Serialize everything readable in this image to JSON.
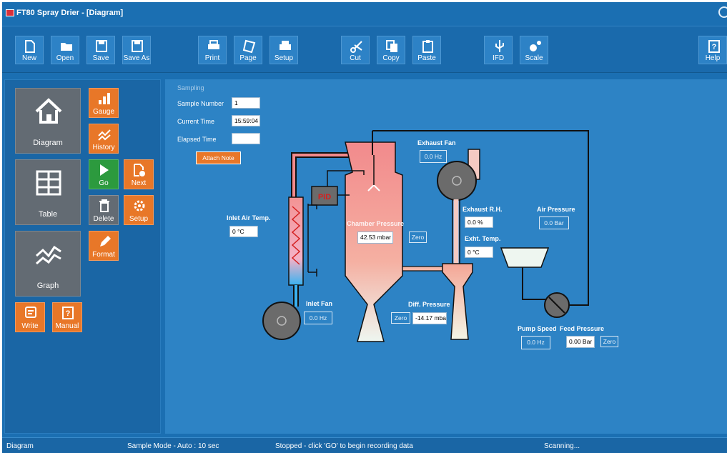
{
  "window": {
    "title": "FT80 Spray Drier - [Diagram]"
  },
  "toolbar": {
    "new": "New",
    "open": "Open",
    "save": "Save",
    "save_as": "Save As",
    "print": "Print",
    "page": "Page",
    "setup": "Setup",
    "cut": "Cut",
    "copy": "Copy",
    "paste": "Paste",
    "ifd": "IFD",
    "scale": "Scale",
    "help": "Help"
  },
  "sidebar": {
    "diagram": "Diagram",
    "table": "Table",
    "graph": "Graph",
    "gauge": "Gauge",
    "history": "History",
    "go": "Go",
    "next": "Next",
    "delete": "Delete",
    "setup": "Setup",
    "format": "Format",
    "write": "Write",
    "manual": "Manual"
  },
  "sampling": {
    "heading": "Sampling",
    "sample_number_label": "Sample Number",
    "sample_number": "1",
    "current_time_label": "Current Time",
    "current_time": "15:59:04",
    "elapsed_time_label": "Elapsed Time",
    "elapsed_time": "",
    "attach_note": "Attach Note"
  },
  "diagram": {
    "pid": "PID",
    "inlet_air_temp_label": "Inlet Air Temp.",
    "inlet_air_temp": "0 °C",
    "inlet_fan_label": "Inlet Fan",
    "inlet_fan": "0.0 Hz",
    "chamber_pressure_label": "Chamber Pressure",
    "chamber_pressure": "42.53 mbar",
    "zero": "Zero",
    "exhaust_fan_label": "Exhaust Fan",
    "exhaust_fan": "0.0 Hz",
    "exhaust_rh_label": "Exhaust R.H.",
    "exhaust_rh": "0.0 %",
    "exht_temp_label": "Exht. Temp.",
    "exht_temp": "0 °C",
    "air_pressure_label": "Air Pressure",
    "air_pressure": "0.0 Bar",
    "diff_pressure_label": "Diff. Pressure",
    "diff_pressure": "-14.17 mba",
    "pump_speed_label": "Pump Speed",
    "pump_speed": "0.0 Hz",
    "feed_pressure_label": "Feed Pressure",
    "feed_pressure": "0.00 Bar"
  },
  "status": {
    "view": "Diagram",
    "mode": "Sample Mode - Auto : 10 sec",
    "message": "Stopped - click 'GO' to begin recording data",
    "scan": "Scanning..."
  },
  "colors": {
    "accent_orange": "#e87728",
    "go_green": "#2c9a3e",
    "panel_blue": "#2d83c5",
    "chamber_pink": "#f08a8a"
  }
}
